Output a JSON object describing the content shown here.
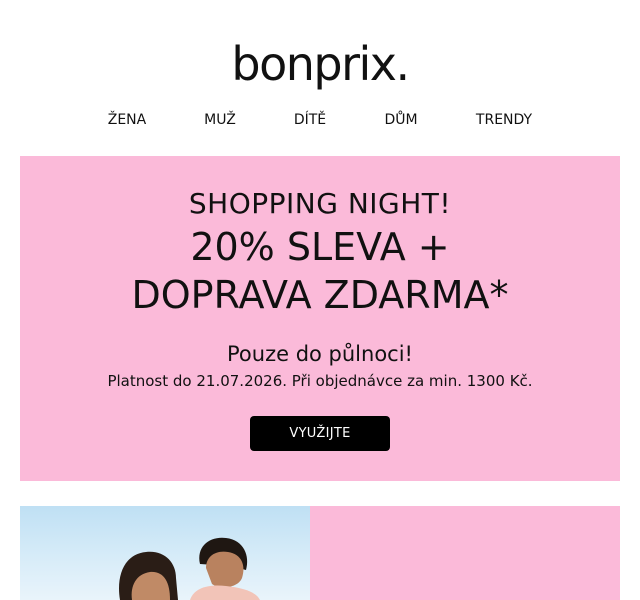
{
  "brand": {
    "logo_text": "bonprix."
  },
  "nav": {
    "items": [
      {
        "label": "ŽENA"
      },
      {
        "label": "MUŽ"
      },
      {
        "label": "DÍTĚ"
      },
      {
        "label": "DŮM"
      },
      {
        "label": "TRENDY"
      }
    ]
  },
  "hero": {
    "eyebrow": "SHOPPING NIGHT!",
    "headline_line1": "20% SLEVA +",
    "headline_line2": "DOPRAVA ZDARMA*",
    "subheadline": "Pouze do půlnoci!",
    "note": "Platnost do 21.07.2026. Při objednávce za min. 1300 Kč.",
    "cta_label": "VYUŽIJTE",
    "background_color": "#fbbad9"
  },
  "colors": {
    "accent_pink": "#fbbad9",
    "cta_background": "#000000",
    "cta_text": "#ffffff"
  }
}
